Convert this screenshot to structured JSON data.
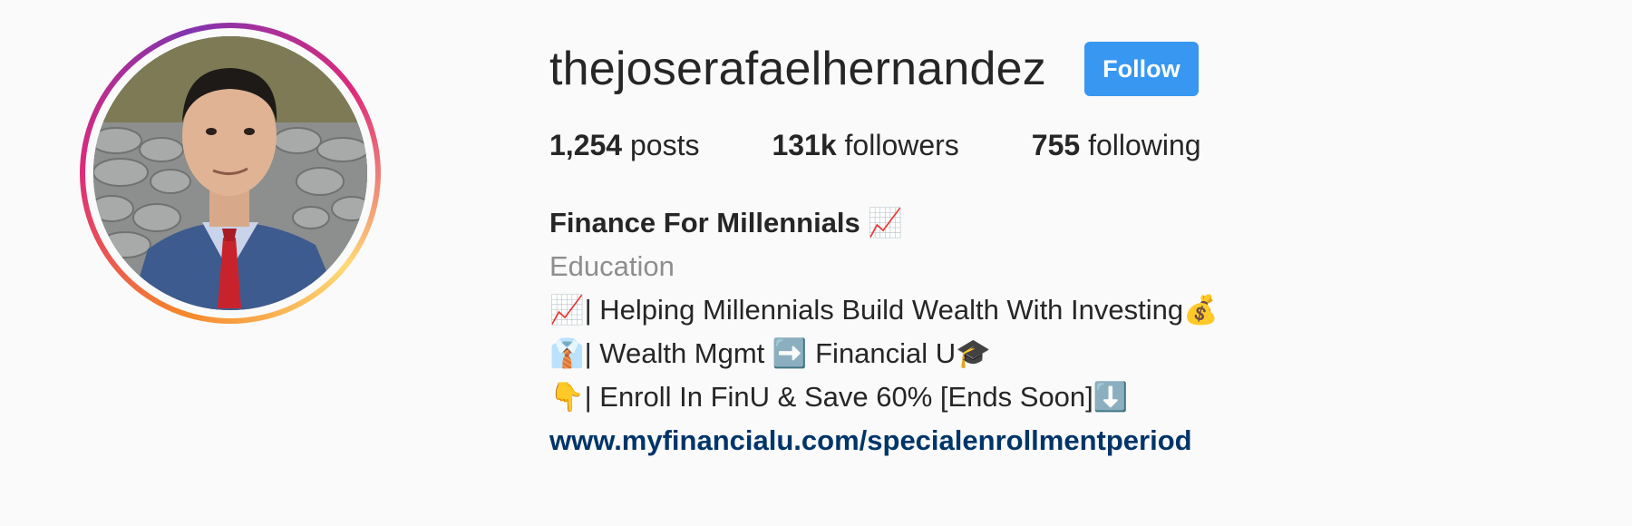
{
  "profile": {
    "username": "thejoserafaelhernandez",
    "follow_label": "Follow",
    "stats": {
      "posts_count": "1,254",
      "posts_label": "posts",
      "followers_count": "131k",
      "followers_label": "followers",
      "following_count": "755",
      "following_label": "following"
    },
    "bio": {
      "name": "Finance For Millennials 📈",
      "category": "Education",
      "lines": [
        "📈| Helping Millennials Build Wealth With Investing💰",
        "👔| Wealth Mgmt ➡️ Financial U🎓",
        "👇| Enroll In FinU & Save 60% [Ends Soon]⬇️"
      ],
      "link": "www.myfinancialu.com/specialenrollmentperiod"
    }
  },
  "colors": {
    "follow_button": "#3897f0",
    "link": "#003569",
    "category": "#8e8e8e",
    "background": "#fafafa"
  }
}
